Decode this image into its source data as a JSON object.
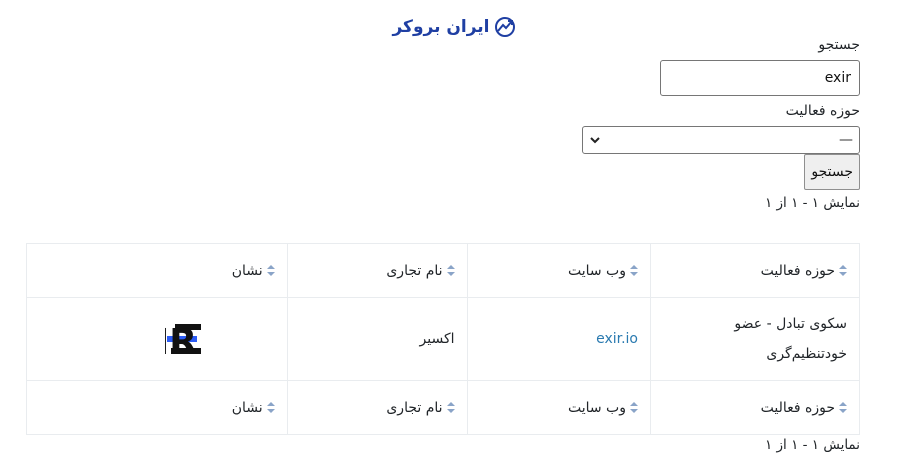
{
  "brand": {
    "name": "ایران بروکر",
    "color": "#1f3fa3"
  },
  "search": {
    "label": "جستجو",
    "value": "exir"
  },
  "activity_filter": {
    "label": "حوزه فعالیت",
    "selected": "—"
  },
  "submit_label": "جستجو",
  "result_count_top": "نمایش ۱ - ۱ از ۱",
  "result_count_bottom": "نمایش ۱ - ۱ از ۱",
  "table": {
    "columns": [
      "حوزه فعالیت",
      "وب سایت",
      "نام تجاری",
      "نشان"
    ],
    "rows": [
      {
        "activity": "سکوی تبادل - عضو خودتنظیم‌گری",
        "website": "exir.io",
        "brand_name": "اکسیر",
        "logo": "EXIR"
      }
    ]
  },
  "colors": {
    "link": "#2a7ab0",
    "sort_icon": "#8aa4c8"
  }
}
